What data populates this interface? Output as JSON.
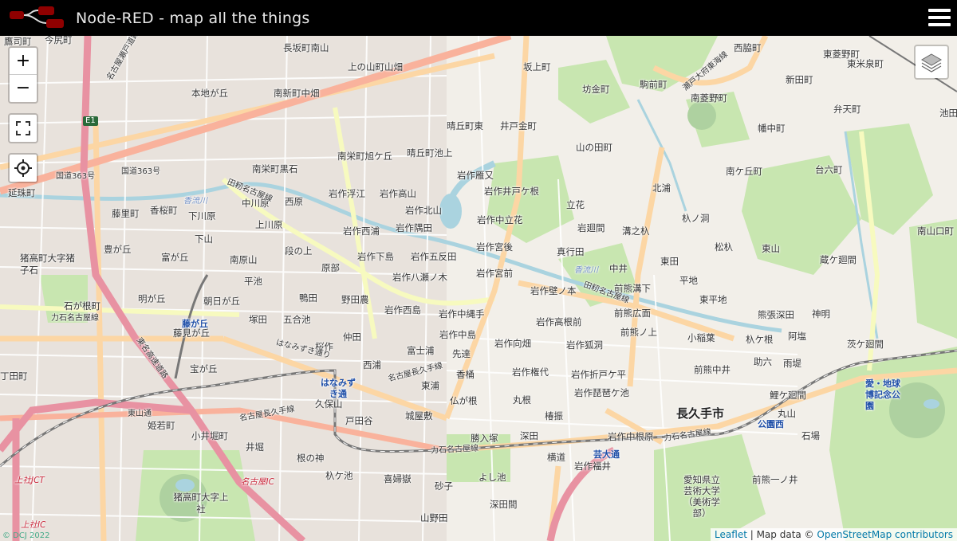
{
  "header": {
    "title": "Node-RED - map all the things"
  },
  "controls": {
    "zoom_in": "+",
    "zoom_out": "−"
  },
  "attribution": {
    "leaflet": "Leaflet",
    "separator": " | Map data © ",
    "osm": "OpenStreetMap contributors"
  },
  "copyright": "© DCJ 2022",
  "colors": {
    "topbar": "#000000",
    "land": "#f2efe9",
    "park": "#c8e6b0",
    "water": "#aad3df",
    "highway": "#e892a2",
    "trunk": "#f9b29c",
    "primary": "#fcd6a4",
    "rail": "#777777"
  },
  "labels": {
    "l1": "鷹司町",
    "l2": "今尻町",
    "l3": "長坂町南山",
    "l4": "上の山町山畑",
    "l5": "坂上町",
    "l6": "西脇町",
    "l7": "東菱野町",
    "l8": "新田町",
    "l9": "東米泉町",
    "l10": "本地が丘",
    "l11": "南新町中畑",
    "l12": "坊金町",
    "l13": "駒前町",
    "l14": "南菱野町",
    "l15": "弁天町",
    "l16": "晴丘町東",
    "l17": "井戸金町",
    "l18": "山の田町",
    "l19": "幡中町",
    "l20": "池田",
    "l21": "南栄町旭ケ丘",
    "l22": "晴丘町池上",
    "l23": "南ケ丘町",
    "l24": "台六町",
    "l25": "南栄町黒石",
    "l26": "岩作雁又",
    "l27": "延珠町",
    "l28": "中川原",
    "l29": "西原",
    "l30": "岩作浮江",
    "l31": "岩作高山",
    "l32": "岩作井戸ケ根",
    "l33": "北浦",
    "l34": "藤里町",
    "l35": "香桜町",
    "l36": "下川原",
    "l37": "岩作北山",
    "l38": "立花",
    "l39": "杁ノ洞",
    "l40": "上川原",
    "l41": "岩作中立花",
    "l42": "南山口町",
    "l43": "岩作西浦",
    "l44": "岩作隅田",
    "l45": "岩廻間",
    "l46": "溝之杁",
    "l47": "下山",
    "l48": "豊が丘",
    "l49": "段の上",
    "l50": "猪高町大字猪子石",
    "l51": "富が丘",
    "l52": "南原山",
    "l53": "原部",
    "l54": "岩作下島",
    "l55": "岩作五反田",
    "l56": "岩作宮後",
    "l57": "真行田",
    "l58": "東田",
    "l59": "松杁",
    "l60": "東山",
    "l61": "蔵ケ廻間",
    "l62": "平池",
    "l63": "岩作八瀬ノ木",
    "l64": "岩作宮前",
    "l65": "中井",
    "l66": "平地",
    "l67": "石が根町",
    "l68": "明が丘",
    "l69": "朝日が丘",
    "l70": "鴨田",
    "l71": "野田農",
    "l72": "岩作壁ノ本",
    "l73": "前熊溝下",
    "l74": "東平地",
    "l75": "塚田",
    "l76": "五合池",
    "l77": "岩作西島",
    "l78": "岩作中縄手",
    "l79": "前熊広面",
    "l80": "熊張深田",
    "l81": "神明",
    "l82": "藤が丘",
    "l83": "藤見が丘",
    "l84": "岩作高根前",
    "l85": "前熊ノ上",
    "l86": "小稲葉",
    "l87": "杁ケ根",
    "l88": "阿塩",
    "l89": "茨ケ廻間",
    "l90": "桜作",
    "l91": "仲田",
    "l92": "岩作中島",
    "l93": "富士浦",
    "l94": "岩作向畑",
    "l95": "岩作狐洞",
    "l96": "助六",
    "l97": "雨堤",
    "l98": "宝が丘",
    "l99": "西浦",
    "l100": "先達",
    "l101": "香桶",
    "l102": "岩作権代",
    "l103": "岩作折戸ケ平",
    "l104": "前熊中井",
    "l105": "丁田町",
    "l106": "はなみずき通",
    "l107": "東浦",
    "l108": "仏が根",
    "l109": "岩作琵琶ケ池",
    "l110": "鯉ケ廻間",
    "l111": "久保山",
    "l112": "丸根",
    "l113": "戸田谷",
    "l114": "城屋敷",
    "l115": "椿振",
    "l116": "長久手市",
    "l117": "丸山",
    "l118": "姫若町",
    "l119": "小井堀町",
    "l120": "深田",
    "l121": "岩作中根原",
    "l122": "井堀",
    "l123": "勝入塚",
    "l124": "石場",
    "l125": "愛・地球博記念公園",
    "l126": "根の神",
    "l127": "横道",
    "l128": "芸大通",
    "l129": "岩作福井",
    "l130": "杁ケ池",
    "l131": "喜婦嶽",
    "l132": "砂子",
    "l133": "よし池",
    "l134": "前熊一ノ井",
    "l135": "猪高町大字上社",
    "l136": "愛知県立芸術大学（美術学部）",
    "l137": "深田間",
    "l138": "山野田",
    "l139": "公園西"
  },
  "road_labels": {
    "r1": "名古屋瀬戸道路",
    "r2": "国道363号",
    "r3": "国道363号",
    "r4": "力石名古屋線",
    "r5": "田籾名古屋線",
    "r6": "力石名古屋線",
    "r7": "名古屋長久手線",
    "r8": "名古屋長久手線",
    "r9": "東名高速道路",
    "r10": "はなみずき通り",
    "r11": "力石名古屋線",
    "r12": "名古屋IC",
    "r13": "上社JCT",
    "r14": "上社IC",
    "r15": "E1",
    "r16": "香流川",
    "r17": "香流川",
    "r18": "瀬戸大府東海線",
    "r19": "田籾名古屋線",
    "r20": "東山通"
  }
}
